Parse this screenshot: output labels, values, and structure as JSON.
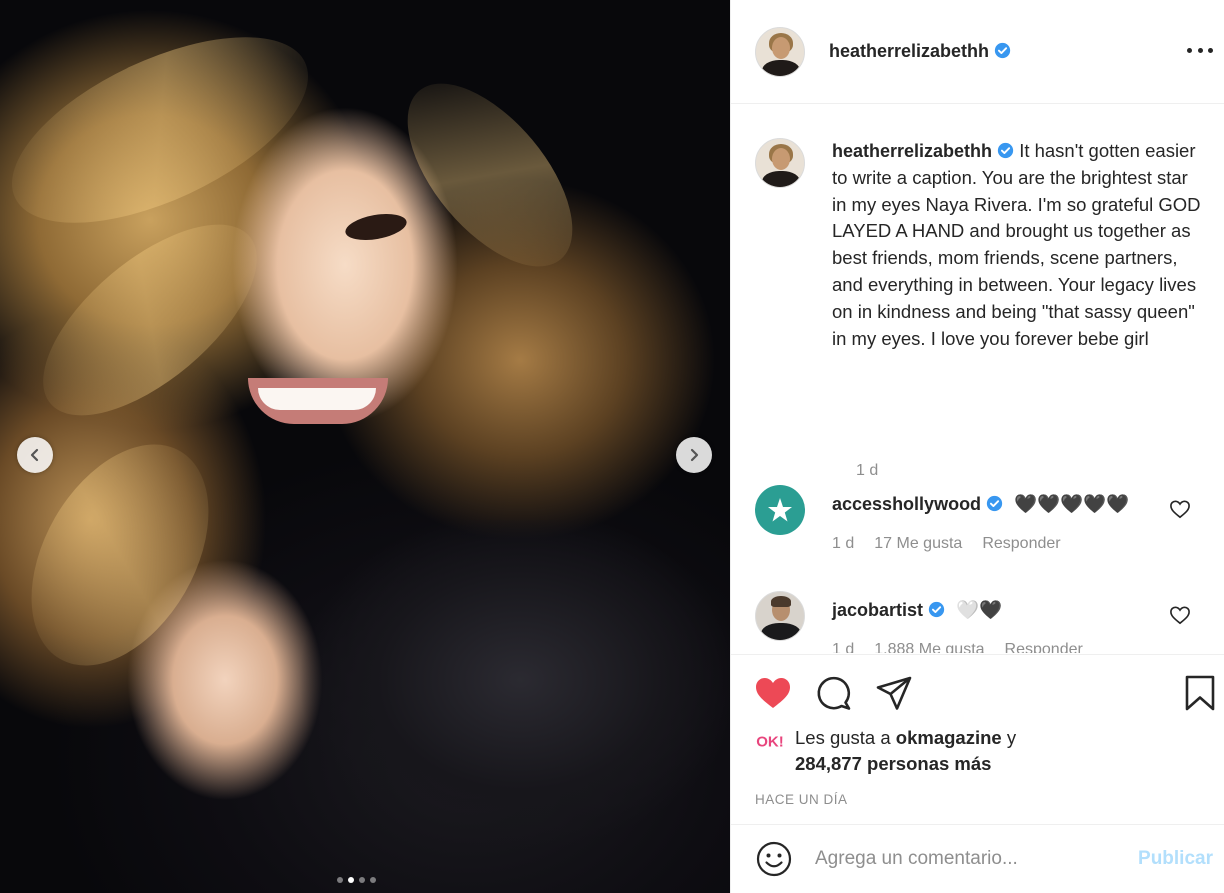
{
  "post": {
    "author": "heatherrelizabethh",
    "caption": "It hasn't gotten easier to write a caption. You are the brightest star in my eyes Naya Rivera. I'm so grateful GOD LAYED A HAND and brought us together as best friends, mom friends, scene partners, and everything in between. Your legacy lives on in kindness and being \"that sassy queen\" in my eyes. I love you forever bebe girl",
    "caption_time": "1 d",
    "carousel": {
      "slide_count": 4,
      "active_index": 1
    }
  },
  "comments": [
    {
      "user": "accesshollywood",
      "verified": true,
      "text": "🖤🖤🖤🖤🖤",
      "time": "1 d",
      "likes": "17 Me gusta",
      "reply": "Responder"
    },
    {
      "user": "jacobartist",
      "verified": true,
      "text": "🤍🖤",
      "time": "1 d",
      "likes": "1.888 Me gusta",
      "reply": "Responder"
    }
  ],
  "likes": {
    "prefix": "Les gusta a",
    "liker": "okmagazine",
    "joiner": "y",
    "others": "284,877 personas más"
  },
  "posted_ago": "HACE UN DÍA",
  "composer": {
    "placeholder": "Agrega un comentario...",
    "publish_label": "Publicar"
  },
  "colors": {
    "verified_blue": "#3897f0",
    "like_red": "#ed4956",
    "publish_disabled": "#b2dffc",
    "access_teal": "#2b9e93",
    "ok_pink": "#e8457d"
  },
  "icons": [
    "verified-badge-icon",
    "more-options-icon",
    "heart-icon",
    "comment-icon",
    "share-icon",
    "bookmark-icon",
    "emoji-icon",
    "chevron-left-icon",
    "chevron-right-icon"
  ]
}
